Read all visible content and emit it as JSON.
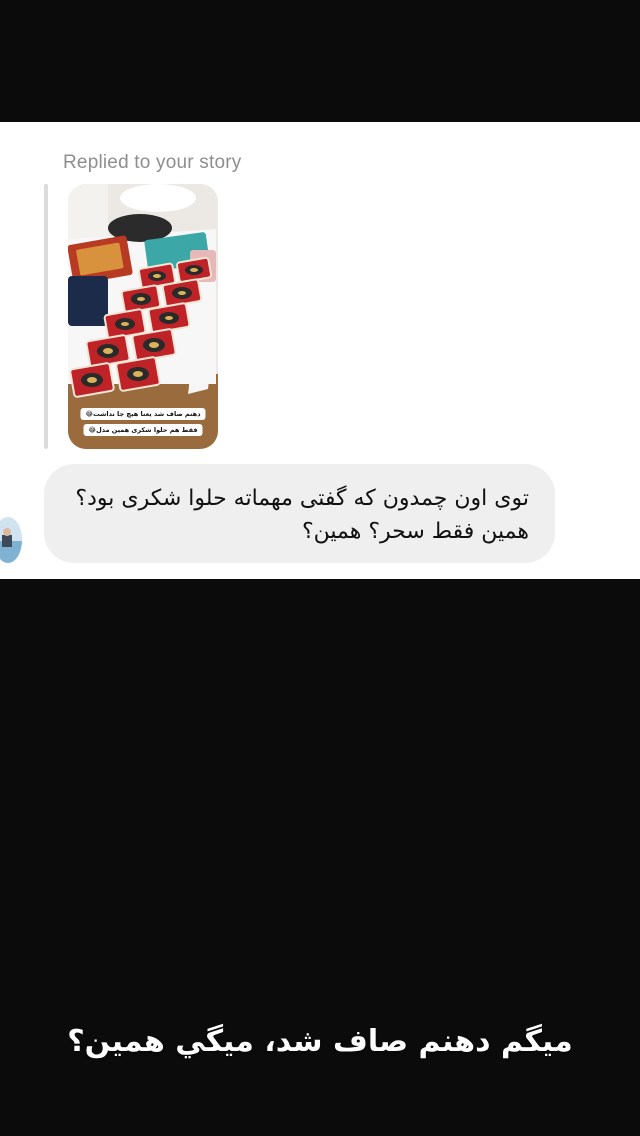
{
  "reply": {
    "label": "Replied to your story"
  },
  "story": {
    "caption_line_1": "دهنم صاف شد یعنا هیچ جا نداشت😂",
    "caption_line_2": "فقط هم حلوا شکری همین مدل😂"
  },
  "message": {
    "text": "توی اون چمدون که گفتی مهماته حلوا شکری بود؟ همین فقط سحر؟ همین؟"
  },
  "overlay": {
    "caption": "میگم دهنم صاف شد، میگي همین؟"
  },
  "colors": {
    "background": "#0b0b0b",
    "card": "#ffffff",
    "bubble": "#efefef",
    "label_gray": "#8e8e8e"
  }
}
